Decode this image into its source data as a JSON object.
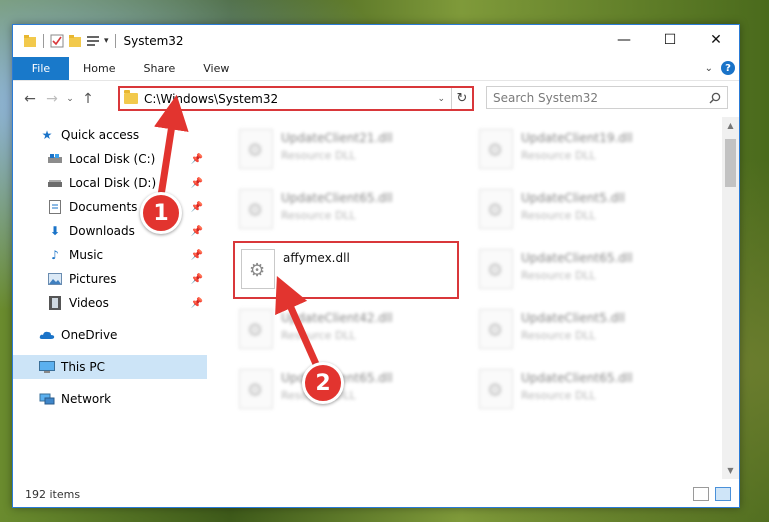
{
  "window": {
    "title": "System32",
    "controls": {
      "minimize": "—",
      "maximize": "☐",
      "close": "✕"
    }
  },
  "ribbon": {
    "tabs": [
      "File",
      "Home",
      "Share",
      "View"
    ],
    "help": "?"
  },
  "address": {
    "path": "C:\\Windows\\System32",
    "search_placeholder": "Search System32"
  },
  "sidebar": {
    "quick_access": "Quick access",
    "pinned": [
      {
        "label": "Local Disk (C:)",
        "icon": "drive-icon"
      },
      {
        "label": "Local Disk (D:)",
        "icon": "drive-icon"
      },
      {
        "label": "Documents",
        "icon": "documents-icon"
      },
      {
        "label": "Downloads",
        "icon": "downloads-icon"
      },
      {
        "label": "Music",
        "icon": "music-icon"
      },
      {
        "label": "Pictures",
        "icon": "pictures-icon"
      },
      {
        "label": "Videos",
        "icon": "videos-icon"
      }
    ],
    "onedrive": "OneDrive",
    "this_pc": "This PC",
    "network": "Network"
  },
  "files": [
    {
      "name": "UpdateClient21.dll",
      "type": "Resource DLL",
      "blurred": true
    },
    {
      "name": "UpdateClient19.dll",
      "type": "Resource DLL",
      "blurred": true
    },
    {
      "name": "UpdateClient65.dll",
      "type": "Resource DLL",
      "blurred": true
    },
    {
      "name": "UpdateClient5.dll",
      "type": "Resource DLL",
      "blurred": true
    },
    {
      "name": "affymex.dll",
      "type": "",
      "blurred": false,
      "highlighted": true
    },
    {
      "name": "UpdateClient65.dll",
      "type": "Resource DLL",
      "blurred": true
    },
    {
      "name": "UpdateClient42.dll",
      "type": "Resource DLL",
      "blurred": true
    },
    {
      "name": "UpdateClient5.dll",
      "type": "Resource DLL",
      "blurred": true
    },
    {
      "name": "UpdateClient65.dll",
      "type": "Resource DLL",
      "blurred": true
    },
    {
      "name": "UpdateClient65.dll",
      "type": "Resource DLL",
      "blurred": true
    }
  ],
  "status": {
    "count": "192 items"
  },
  "annotations": {
    "step1": "1",
    "step2": "2"
  },
  "colors": {
    "accent": "#1979ca",
    "highlight": "#d9373a",
    "selected": "#cce4f7"
  }
}
